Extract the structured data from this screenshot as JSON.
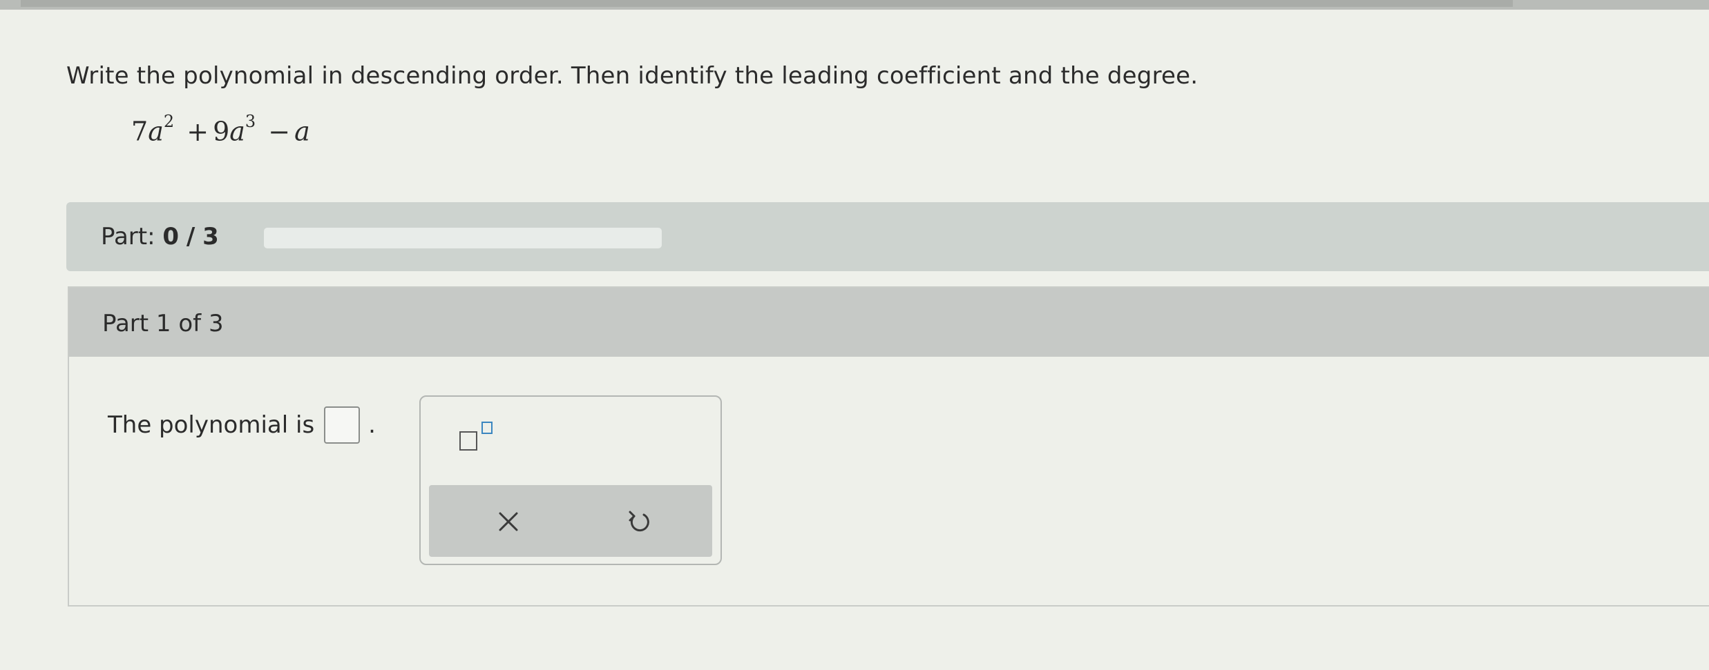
{
  "question": {
    "prompt": "Write the polynomial in descending order. Then identify the leading coefficient and the degree.",
    "expression": {
      "term1_coef": "7",
      "term1_var": "a",
      "term1_exp": "2",
      "op1": "+",
      "term2_coef": "9",
      "term2_var": "a",
      "term2_exp": "3",
      "op2": "−",
      "term3_var": "a"
    }
  },
  "progress": {
    "label": "Part:",
    "current": "0",
    "separator": "/",
    "total": "3",
    "fill_percent": 0
  },
  "part": {
    "header": "Part 1 of 3",
    "answer_label": "The polynomial is",
    "answer_value": "",
    "period": "."
  },
  "palette": {
    "exponent_tool_icon": "superscript-icon",
    "clear_icon": "x-icon",
    "undo_icon": "undo-icon"
  },
  "colors": {
    "accent": "#3b86c0",
    "part_bar": "#cdd3cf",
    "part_header": "#c6c9c6"
  }
}
